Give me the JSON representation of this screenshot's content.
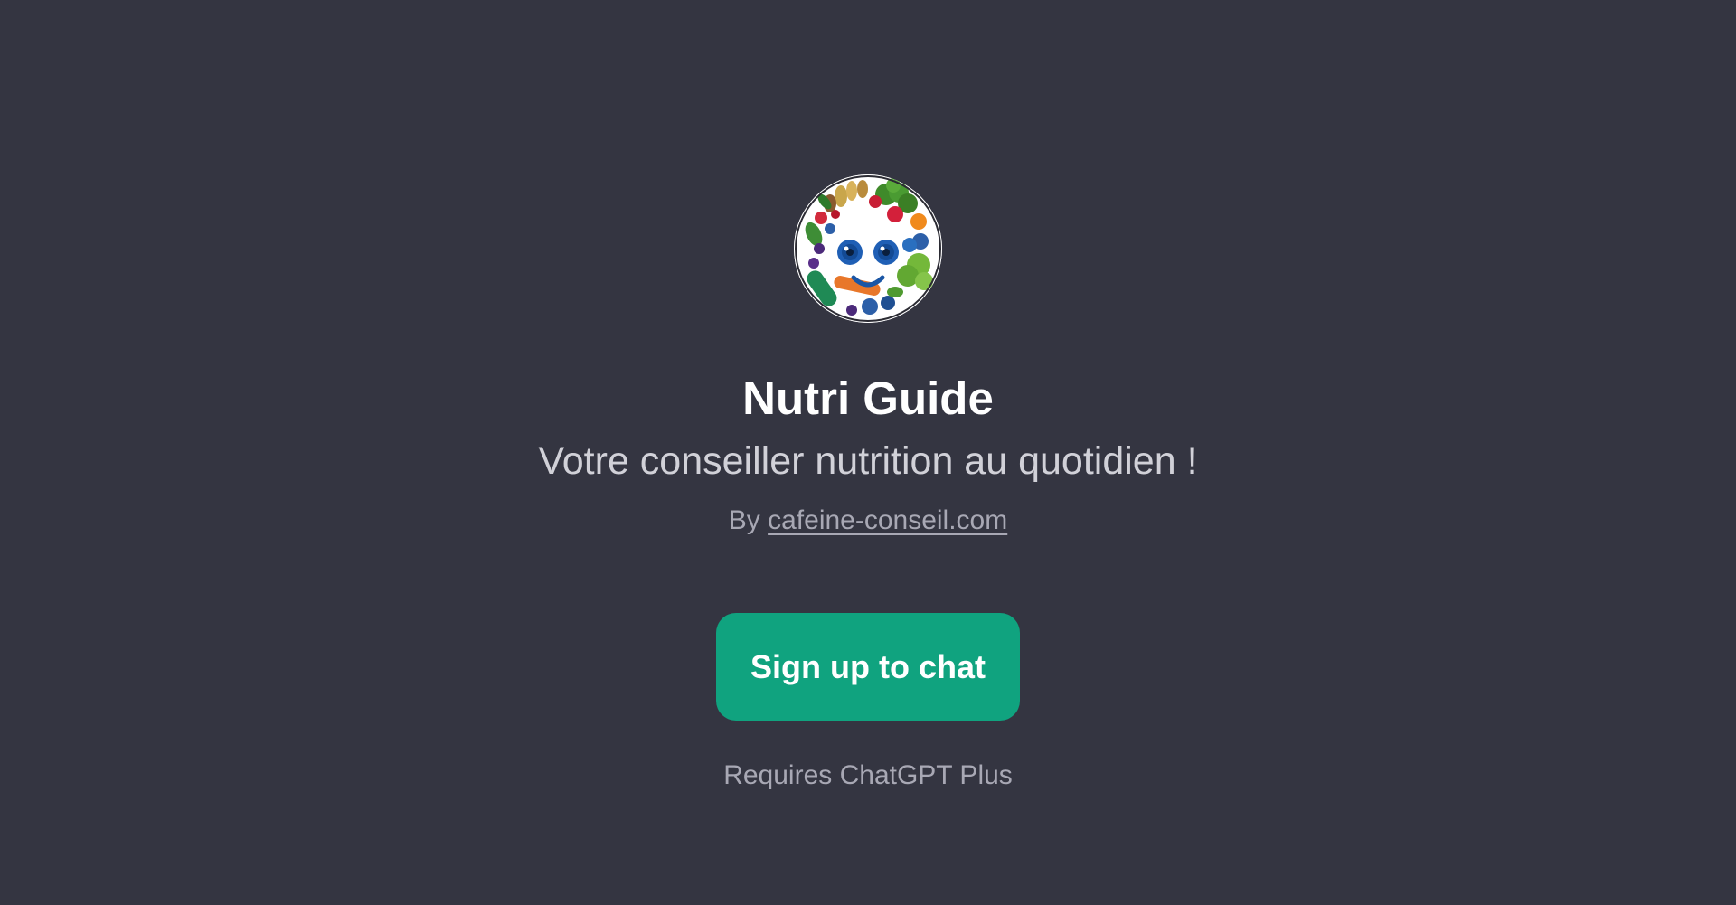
{
  "gpt": {
    "avatar_icon": "vegetable-smiley-face-icon",
    "title": "Nutri Guide",
    "description": "Votre conseiller nutrition au quotidien !",
    "by_prefix": "By",
    "author_link": "cafeine-conseil.com"
  },
  "cta": {
    "signup_label": "Sign up to chat",
    "requirement_note": "Requires ChatGPT Plus"
  },
  "colors": {
    "background": "#343541",
    "accent": "#10a37f",
    "title": "#ffffff",
    "muted": "#a8a8b4"
  }
}
